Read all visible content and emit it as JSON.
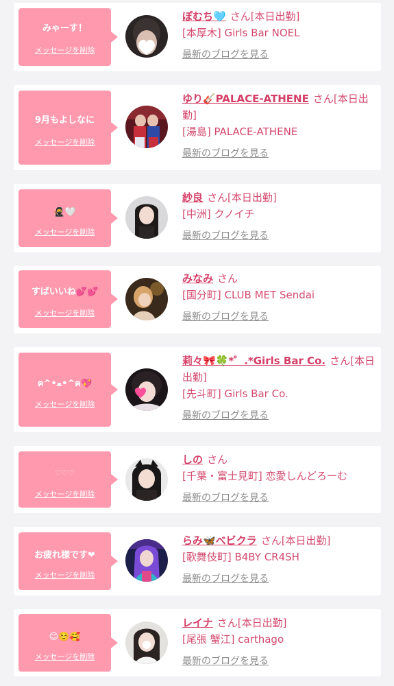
{
  "delete_label": "メッセージを削除",
  "blog_label": "最新のブログを見る",
  "san": "さん",
  "cards": [
    {
      "message": "みゃーす！",
      "name": "ぽむち🩵",
      "status": "[本日出勤]",
      "shop": "[本厚木] Girls Bar NOEL"
    },
    {
      "message": "9月もよしなに",
      "name": "ゆり🎸PALACE-ATHENE",
      "status": "[本日出勤]",
      "shop": "[湯島] PALACE-ATHENE"
    },
    {
      "message": "🥷🤍",
      "name": "紗良",
      "status": "[本日出勤]",
      "shop": "[中洲] クノイチ"
    },
    {
      "message": "すばいいね💕💕",
      "name": "みなみ",
      "status": "",
      "shop": "[国分町] CLUB MET Sendai"
    },
    {
      "message": "ฅ^•ﻌ•^ฅ💖",
      "name": "莉々🎀🍀*゜.*Girls Bar Co.",
      "status": "[本日出勤]",
      "shop": "[先斗町] Girls Bar Co."
    },
    {
      "message": "♡♡♡",
      "name": "しの",
      "status": "",
      "shop": "[千葉・富士見町] 恋愛しんどろーむ"
    },
    {
      "message": "お疲れ様です❤",
      "name": "らみ🦋べビクラ",
      "status": "[本日出勤]",
      "shop": "[歌舞伎町] B4BY CR4SH"
    },
    {
      "message": "😊☺️🥰",
      "name": "レイナ",
      "status": "[本日出勤]",
      "shop": "[尾張 蟹江] carthago"
    }
  ],
  "colors": {
    "bubble": "#ff99ae",
    "name": "#d43f66",
    "text": "#d44a6e",
    "blog_link": "#8c8c8c",
    "background": "#f3f3f5"
  }
}
